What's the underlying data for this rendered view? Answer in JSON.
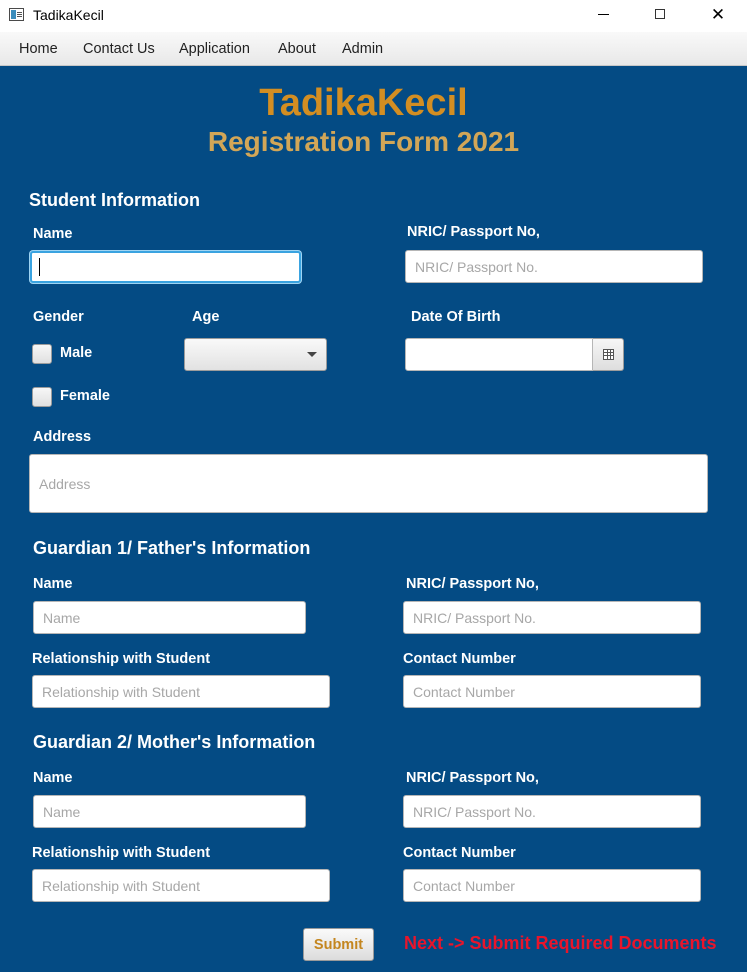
{
  "window": {
    "title": "TadikaKecil",
    "close_glyph": "✕"
  },
  "menu": {
    "items": [
      "Home",
      "Contact Us",
      "Application",
      "About",
      "Admin"
    ]
  },
  "header": {
    "title": "TadikaKecil",
    "subtitle": "Registration Form 2021"
  },
  "student": {
    "section_title": "Student Information",
    "name_label": "Name",
    "name_value": "",
    "nric_label": "NRIC/ Passport No,",
    "nric_placeholder": "NRIC/ Passport No.",
    "gender_label": "Gender",
    "male_label": "Male",
    "female_label": "Female",
    "male_checked": false,
    "female_checked": false,
    "age_label": "Age",
    "age_value": "",
    "dob_label": "Date Of Birth",
    "dob_value": "",
    "address_label": "Address",
    "address_placeholder": "Address"
  },
  "guardian1": {
    "section_title": "Guardian 1/ Father's  Information",
    "name_label": "Name",
    "name_placeholder": "Name",
    "nric_label": "NRIC/ Passport No,",
    "nric_placeholder": "NRIC/ Passport No.",
    "relationship_label": "Relationship with Student",
    "relationship_placeholder": "Relationship with Student",
    "contact_label": "Contact Number",
    "contact_placeholder": "Contact Number"
  },
  "guardian2": {
    "section_title": "Guardian 2/ Mother's  Information",
    "name_label": "Name",
    "name_placeholder": "Name",
    "nric_label": "NRIC/ Passport No,",
    "nric_placeholder": "NRIC/ Passport No.",
    "relationship_label": "Relationship with Student",
    "relationship_placeholder": "Relationship with Student",
    "contact_label": "Contact Number",
    "contact_placeholder": "Contact Number"
  },
  "footer": {
    "submit_label": "Submit",
    "next_text": "Next -> Submit Required Documents"
  },
  "colors": {
    "panel_background": "#044b84",
    "title": "#d38e22",
    "subtitle": "#d2a657",
    "next_text": "#e9152b",
    "focus_ring": "#3aa3e0"
  },
  "icons": {
    "app": "app-window-icon",
    "minimize": "minimize-icon",
    "maximize": "maximize-icon",
    "close": "close-icon",
    "dropdown": "chevron-down-icon",
    "calendar": "calendar-icon"
  }
}
